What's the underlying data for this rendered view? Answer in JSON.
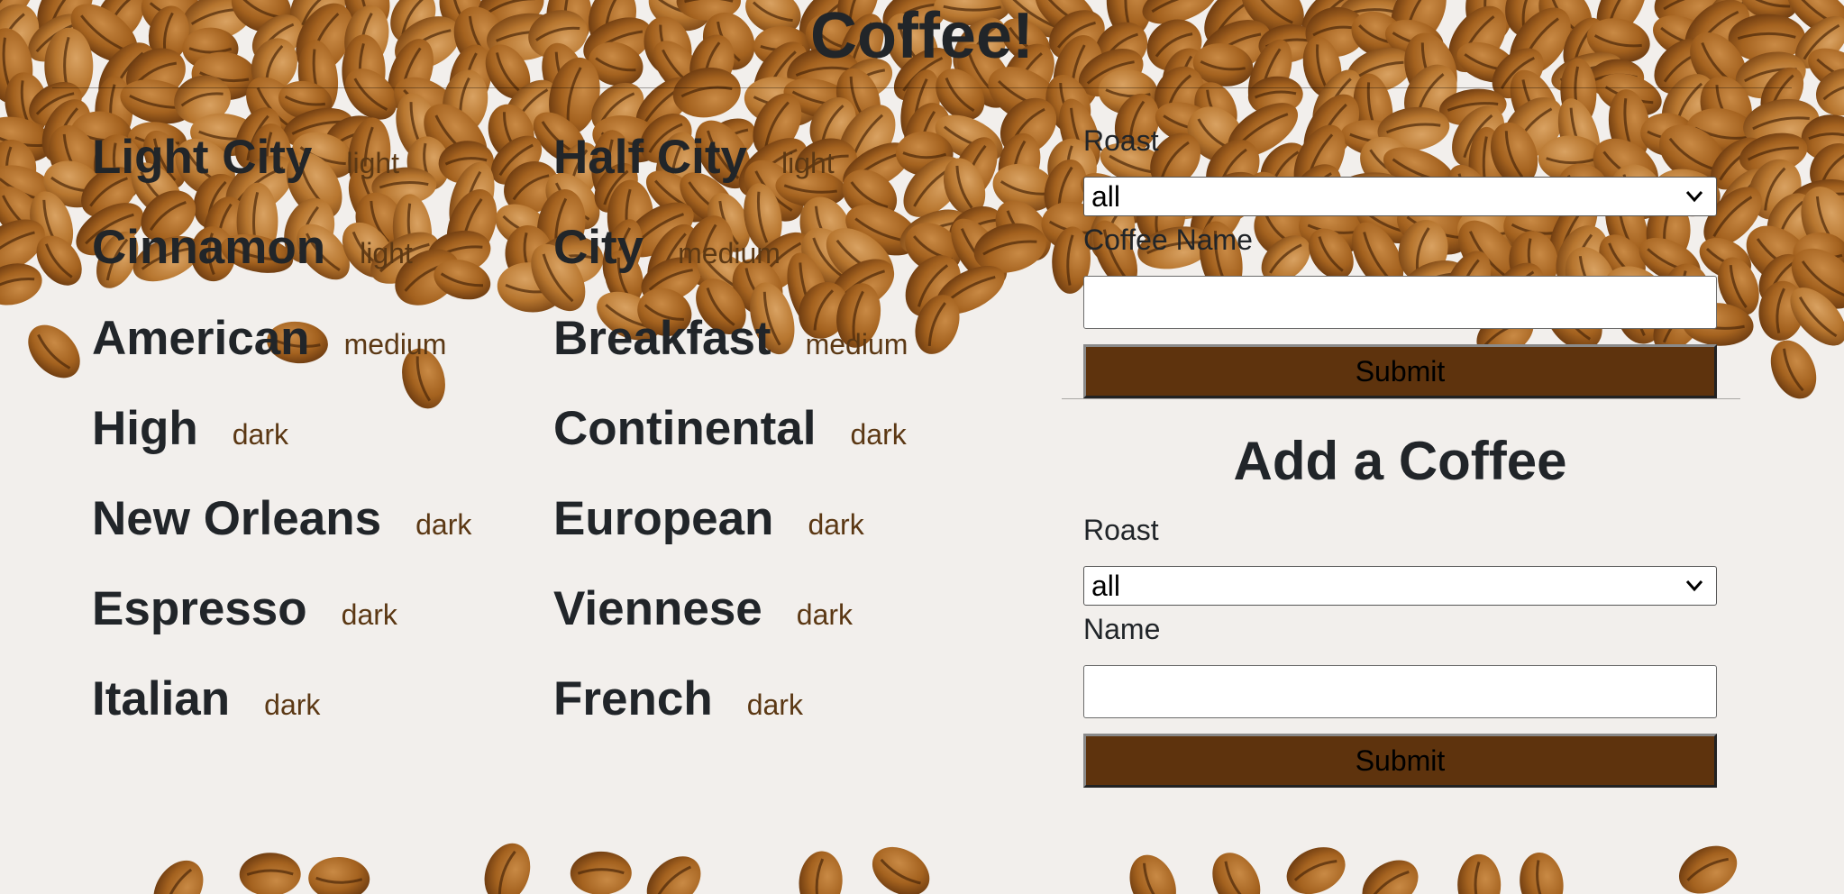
{
  "page": {
    "title": "Coffee!"
  },
  "coffees": {
    "left": [
      {
        "name": "Light City",
        "roast": "light"
      },
      {
        "name": "Cinnamon",
        "roast": "light"
      },
      {
        "name": "American",
        "roast": "medium"
      },
      {
        "name": "High",
        "roast": "dark"
      },
      {
        "name": "New Orleans",
        "roast": "dark"
      },
      {
        "name": "Espresso",
        "roast": "dark"
      },
      {
        "name": "Italian",
        "roast": "dark"
      }
    ],
    "right": [
      {
        "name": "Half City",
        "roast": "light"
      },
      {
        "name": "City",
        "roast": "medium"
      },
      {
        "name": "Breakfast",
        "roast": "medium"
      },
      {
        "name": "Continental",
        "roast": "dark"
      },
      {
        "name": "European",
        "roast": "dark"
      },
      {
        "name": "Viennese",
        "roast": "dark"
      },
      {
        "name": "French",
        "roast": "dark"
      }
    ]
  },
  "filter_form": {
    "roast_label": "Roast",
    "roast_value": "all",
    "name_label": "Coffee Name",
    "name_value": "",
    "submit_label": "Submit"
  },
  "add_form": {
    "heading": "Add a Coffee",
    "roast_label": "Roast",
    "roast_value": "all",
    "name_label": "Name",
    "name_value": "",
    "submit_label": "Submit"
  },
  "colors": {
    "button_bg": "#5e330d",
    "roast_text": "#5b3814",
    "text": "#212529"
  }
}
